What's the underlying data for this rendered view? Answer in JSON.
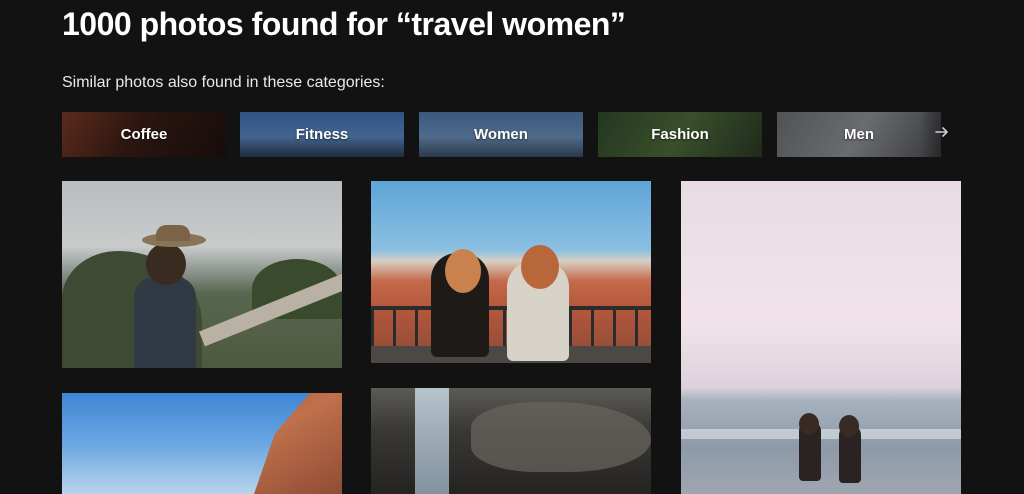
{
  "header": {
    "title": "1000 photos found for “travel women”",
    "subtitle": "Similar photos also found in these categories:"
  },
  "categories": [
    {
      "label": "Coffee"
    },
    {
      "label": "Fitness"
    },
    {
      "label": "Women"
    },
    {
      "label": "Fashion"
    },
    {
      "label": "Men"
    }
  ],
  "icons": {
    "next": "arrow-right-icon"
  },
  "colors": {
    "background": "#121212",
    "text": "#ffffff"
  }
}
